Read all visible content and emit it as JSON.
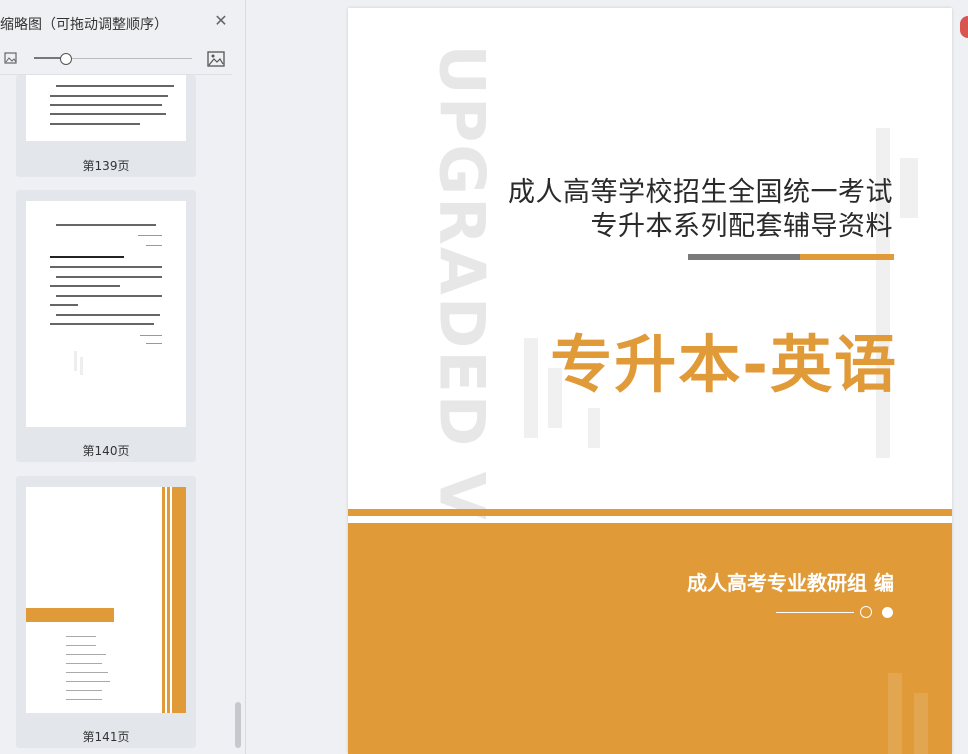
{
  "sidebar": {
    "title": "缩略图（可拖动调整顺序）",
    "zoom_level": 0.2,
    "thumbnails": [
      {
        "label": "第139页"
      },
      {
        "label": "第140页"
      },
      {
        "label": "第141页"
      }
    ]
  },
  "document": {
    "cover": {
      "watermark": "UPGRADED VERSION",
      "title_line1": "成人高等学校招生全国统一考试",
      "title_line2": "专升本系列配套辅导资料",
      "main_title": "专升本-英语",
      "author": "成人高考专业教研组 编"
    }
  },
  "colors": {
    "accent": "#e09a38",
    "gray_bar": "#7a7a7a",
    "background": "#eef0f3"
  }
}
